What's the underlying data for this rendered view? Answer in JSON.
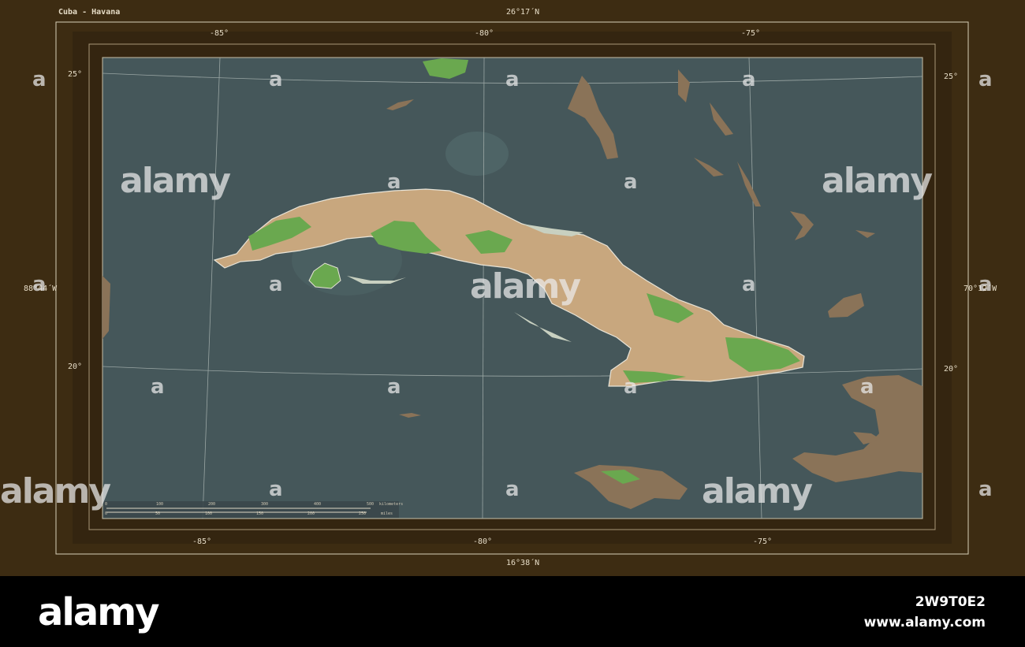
{
  "map": {
    "title": "Cuba - Havana",
    "top_lat_label": "26°17´N",
    "bottom_lat_label": "16°38´N",
    "left_lon_label": "88°44´W",
    "right_lon_label": "70°12´W",
    "top_lon_ticks": [
      "-85°",
      "-80°",
      "-75°"
    ],
    "bottom_lon_ticks": [
      "-85°",
      "-80°",
      "-75°"
    ],
    "left_lat_ticks": [
      "25°",
      "20°"
    ],
    "right_lat_ticks": [
      "25°",
      "20°"
    ],
    "colors": {
      "frame": "#3d2c12",
      "water": "#45575a",
      "land": "#c8a77e",
      "forest": "#6aa84f",
      "other_land": "#8a7358"
    }
  },
  "scale_bar": {
    "km_ticks": [
      "0",
      "100",
      "200",
      "300",
      "400",
      "500"
    ],
    "km_unit": "kilometers",
    "mi_ticks": [
      "0",
      "50",
      "100",
      "150",
      "200",
      "250",
      "300"
    ],
    "mi_unit": "miles"
  },
  "watermark": {
    "word": "alamy",
    "letter": "a"
  },
  "footer": {
    "logo": "alamy",
    "image_id": "2W9T0E2",
    "site": "www.alamy.com"
  }
}
